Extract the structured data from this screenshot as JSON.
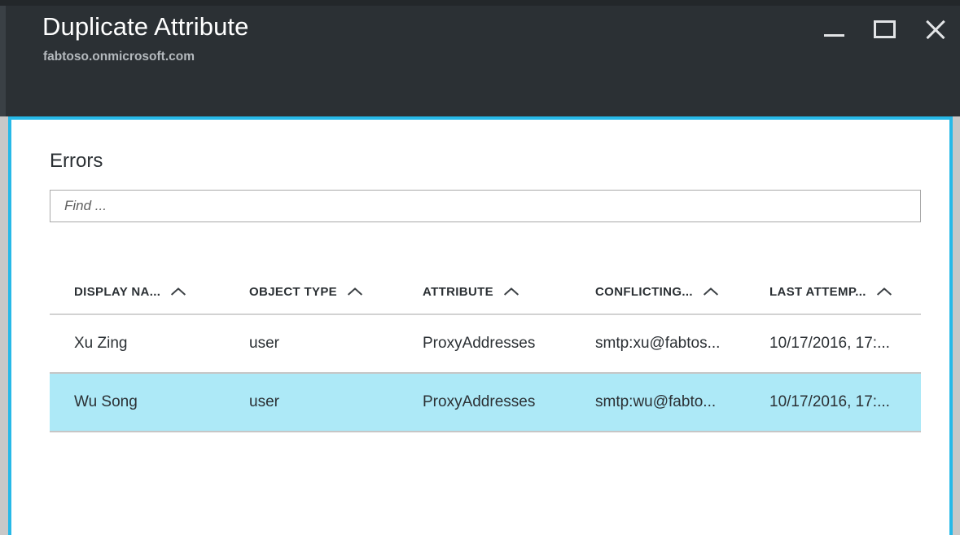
{
  "window": {
    "title": "Duplicate Attribute",
    "subtitle": "fabtoso.onmicrosoft.com",
    "accent_color": "#27b9e8",
    "titlebar_color": "#2b3034",
    "controls": {
      "minimize": "minimize",
      "maximize": "maximize",
      "close": "close"
    }
  },
  "content": {
    "section_heading": "Errors",
    "search": {
      "value": "",
      "placeholder": "Find ..."
    },
    "table": {
      "columns": [
        {
          "label": "DISPLAY NA...",
          "sort_icon": "chevron-up-icon"
        },
        {
          "label": "OBJECT TYPE",
          "sort_icon": "chevron-up-icon"
        },
        {
          "label": "ATTRIBUTE",
          "sort_icon": "chevron-up-icon"
        },
        {
          "label": "CONFLICTING...",
          "sort_icon": "chevron-up-icon"
        },
        {
          "label": "LAST ATTEMP...",
          "sort_icon": "chevron-up-icon"
        }
      ],
      "rows": [
        {
          "display_name": "Xu Zing",
          "object_type": "user",
          "attribute": "ProxyAddresses",
          "conflicting_value": "smtp:xu@fabtos...",
          "last_attempt": "10/17/2016, 17:...",
          "selected": false
        },
        {
          "display_name": "Wu Song",
          "object_type": "user",
          "attribute": "ProxyAddresses",
          "conflicting_value": "smtp:wu@fabto...",
          "last_attempt": "10/17/2016, 17:...",
          "selected": true
        }
      ],
      "selected_row_color": "#ade9f7"
    }
  }
}
